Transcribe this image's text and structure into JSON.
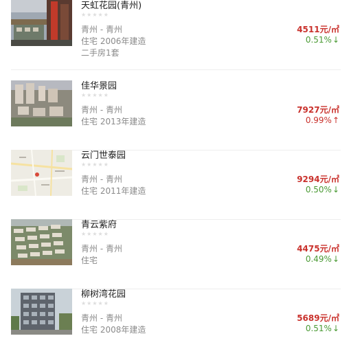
{
  "listings": [
    {
      "name": "天虹花园(青州)",
      "location": "青州 - 青州",
      "type_year": "住宅 2006年建造",
      "extra": "二手房1套",
      "price": "4511元/㎡",
      "change": "0.51%",
      "direction": "down",
      "arrow": "↓",
      "image": "building-photo"
    },
    {
      "name": "佳华景园",
      "location": "青州 - 青州",
      "type_year": "住宅 2013年建造",
      "extra": "",
      "price": "7927元/㎡",
      "change": "0.99%",
      "direction": "up",
      "arrow": "↑",
      "image": "aerial-render"
    },
    {
      "name": "云门世泰园",
      "location": "青州 - 青州",
      "type_year": "住宅 2011年建造",
      "extra": "",
      "price": "9294元/㎡",
      "change": "0.50%",
      "direction": "down",
      "arrow": "↓",
      "image": "location-map"
    },
    {
      "name": "青云紫府",
      "location": "青州 - 青州",
      "type_year": "住宅",
      "extra": "",
      "price": "4475元/㎡",
      "change": "0.49%",
      "direction": "down",
      "arrow": "↓",
      "image": "aerial-render"
    },
    {
      "name": "柳树湾花园",
      "location": "青州 - 青州",
      "type_year": "住宅 2008年建造",
      "extra": "",
      "price": "5689元/㎡",
      "change": "0.51%",
      "direction": "down",
      "arrow": "↓",
      "image": "building-photo"
    }
  ],
  "rating_stars": 5,
  "colors": {
    "price": "#c9312c",
    "down": "#4a9a34",
    "up": "#c9312c",
    "meta": "#8a8a8a"
  }
}
